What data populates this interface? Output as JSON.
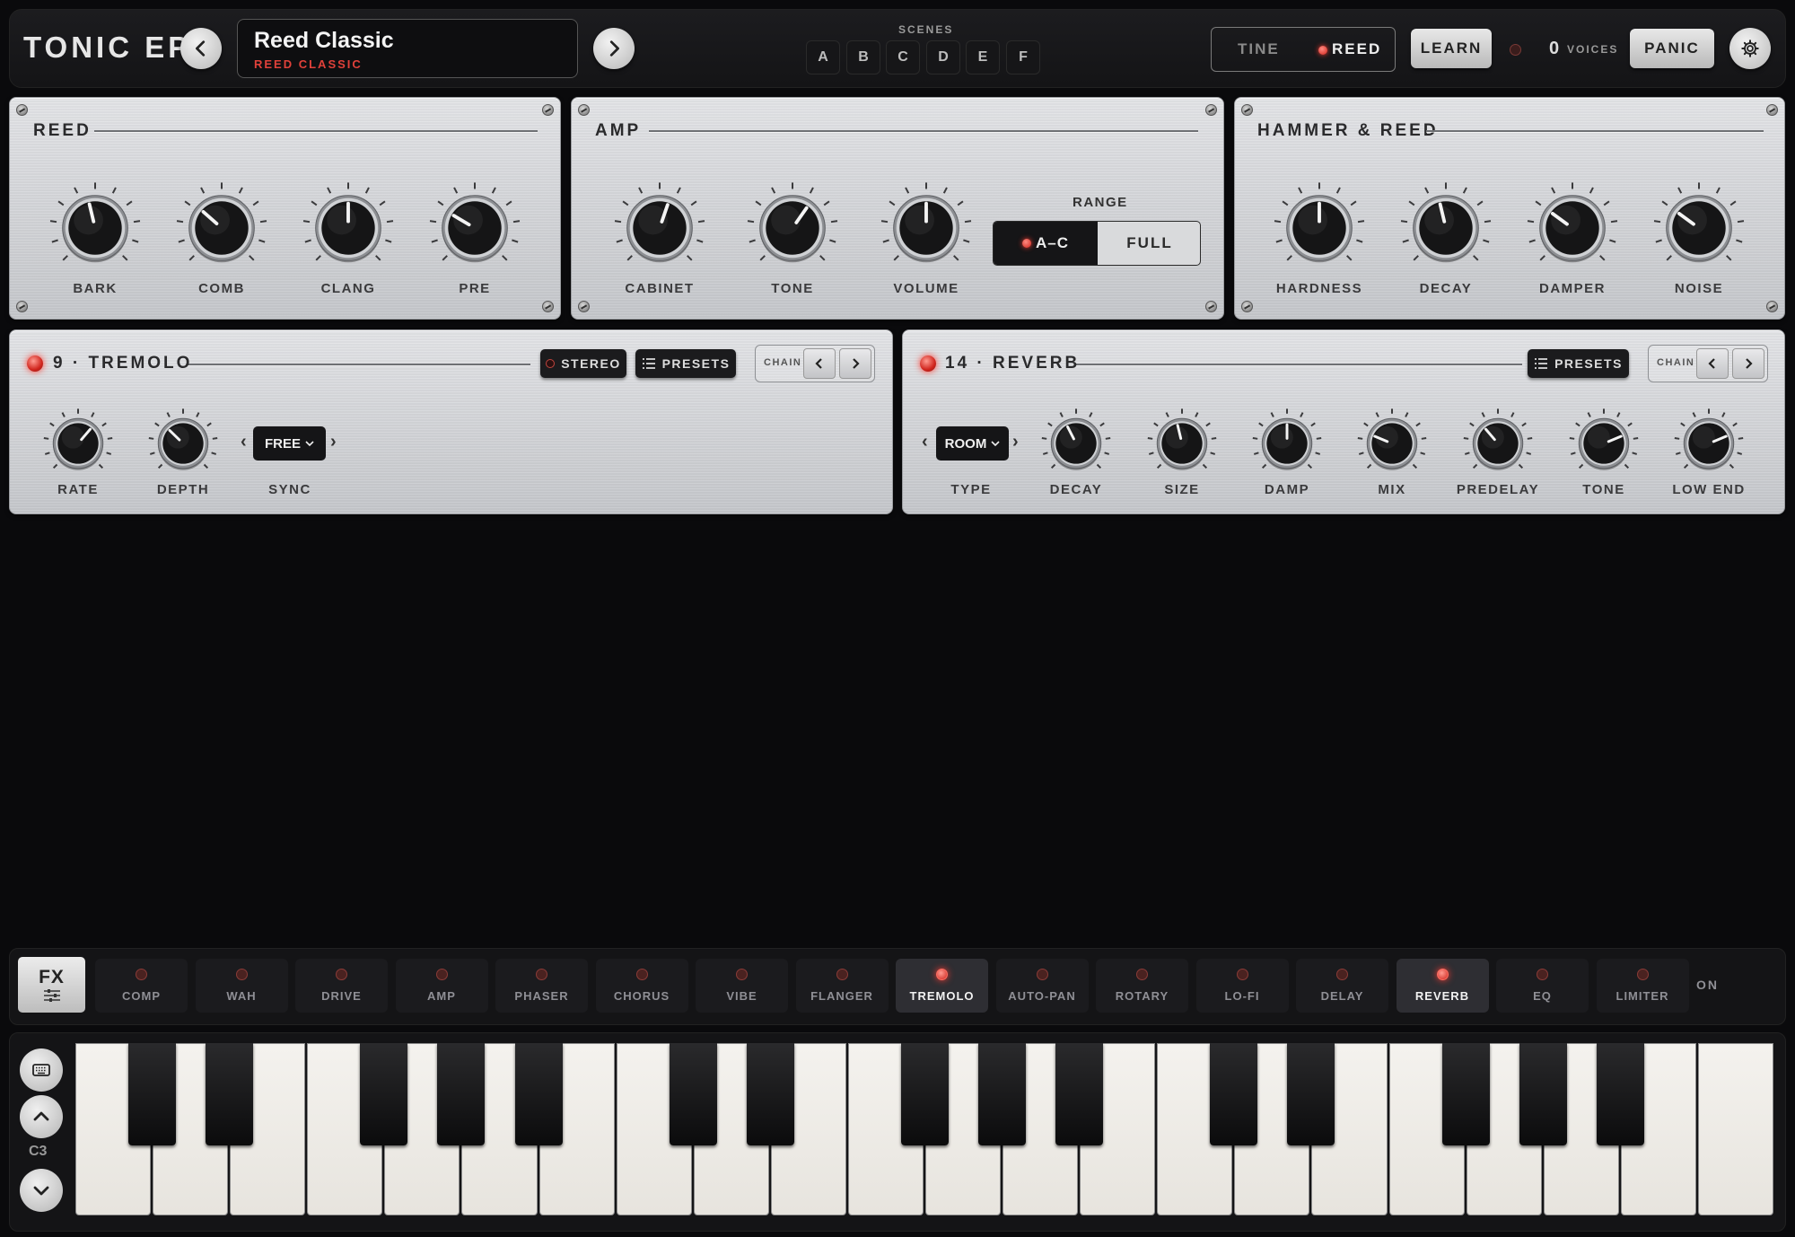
{
  "app": {
    "title": "TONIC EP",
    "preset_name": "Reed Classic",
    "preset_sub": "REED CLASSIC",
    "scenes_label": "SCENES",
    "scenes": [
      "A",
      "B",
      "C",
      "D",
      "E",
      "F"
    ],
    "engine_tine": "TINE",
    "engine_reed": "REED",
    "learn": "LEARN",
    "voices_count": "0",
    "voices_label": "VOICES",
    "panic": "PANIC"
  },
  "reed": {
    "title": "REED",
    "knobs": [
      {
        "label": "BARK",
        "value": 0.45
      },
      {
        "label": "COMB",
        "value": 0.32
      },
      {
        "label": "CLANG",
        "value": 0.5
      },
      {
        "label": "PRE",
        "value": 0.28
      }
    ]
  },
  "amp": {
    "title": "AMP",
    "knobs": [
      {
        "label": "CABINET",
        "value": 0.57
      },
      {
        "label": "TONE",
        "value": 0.63
      },
      {
        "label": "VOLUME",
        "value": 0.5
      }
    ],
    "range_label": "RANGE",
    "range_a": "A–C",
    "range_b": "FULL"
  },
  "hammer": {
    "title": "HAMMER & REED",
    "knobs": [
      {
        "label": "HARDNESS",
        "value": 0.5
      },
      {
        "label": "DECAY",
        "value": 0.45
      },
      {
        "label": "DAMPER",
        "value": 0.3
      },
      {
        "label": "NOISE",
        "value": 0.3
      }
    ]
  },
  "tremolo": {
    "title": "9 · TREMOLO",
    "stereo": "STEREO",
    "presets": "PRESETS",
    "chain": "CHAIN",
    "knobs": [
      {
        "label": "RATE",
        "value": 0.65
      },
      {
        "label": "DEPTH",
        "value": 0.33
      }
    ],
    "sync_value": "FREE",
    "sync_label": "SYNC"
  },
  "reverb": {
    "title": "14 · REVERB",
    "presets": "PRESETS",
    "chain": "CHAIN",
    "type_value": "ROOM",
    "type_label": "TYPE",
    "knobs": [
      {
        "label": "DECAY",
        "value": 0.4
      },
      {
        "label": "SIZE",
        "value": 0.45
      },
      {
        "label": "DAMP",
        "value": 0.5
      },
      {
        "label": "MIX",
        "value": 0.25
      },
      {
        "label": "PREDELAY",
        "value": 0.35
      },
      {
        "label": "TONE",
        "value": 0.75
      },
      {
        "label": "LOW END",
        "value": 0.75
      }
    ]
  },
  "fx": {
    "main": "FX",
    "slots": [
      {
        "label": "COMP",
        "active": false
      },
      {
        "label": "WAH",
        "active": false
      },
      {
        "label": "DRIVE",
        "active": false
      },
      {
        "label": "AMP",
        "active": false
      },
      {
        "label": "PHASER",
        "active": false
      },
      {
        "label": "CHORUS",
        "active": false
      },
      {
        "label": "VIBE",
        "active": false
      },
      {
        "label": "FLANGER",
        "active": false
      },
      {
        "label": "TREMOLO",
        "active": true
      },
      {
        "label": "AUTO-PAN",
        "active": false
      },
      {
        "label": "ROTARY",
        "active": false
      },
      {
        "label": "LO-FI",
        "active": false
      },
      {
        "label": "DELAY",
        "active": false
      },
      {
        "label": "REVERB",
        "active": true
      },
      {
        "label": "EQ",
        "active": false
      },
      {
        "label": "LIMITER",
        "active": false
      }
    ],
    "on_label": "ON"
  },
  "keyboard": {
    "octave": "C3",
    "white_keys": 22
  },
  "icons": {
    "prev": "chevron-left-icon",
    "next": "chevron-right-icon",
    "settings": "gear-icon",
    "keyboard": "keyboard-icon",
    "octave_up": "chevron-up-icon",
    "octave_down": "chevron-down-icon",
    "presets": "list-icon",
    "fx": "sliders-icon"
  },
  "colors": {
    "accent_red": "#e0413a",
    "panel_metal": "#d3d5d8",
    "background": "#0a0a0c"
  }
}
